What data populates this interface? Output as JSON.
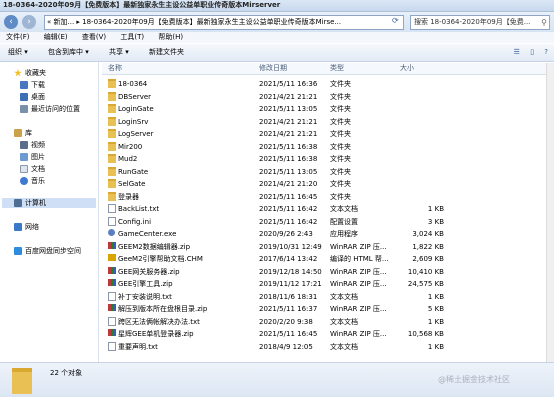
{
  "window": {
    "title": "18-0364-2020年09月【免费版本】最新独家永生主设公益单职业传奇版本Mirserver"
  },
  "address": {
    "path": "« 新加... ▸ 18-0364-2020年09月【免费版本】最新独家永生主设公益单职业传奇版本Mirse..."
  },
  "search": {
    "placeholder": "搜索 18-0364-2020年09月【免费..."
  },
  "menu": [
    "文件(F)",
    "编辑(E)",
    "查看(V)",
    "工具(T)",
    "帮助(H)"
  ],
  "toolbar": {
    "organize": "组织 ▾",
    "include": "包含到库中 ▾",
    "share": "共享 ▾",
    "new_folder": "新建文件夹"
  },
  "nav": {
    "favorites": "收藏夹",
    "favorites_items": [
      "下载",
      "桌面",
      "最近访问的位置"
    ],
    "library": "库",
    "library_items": [
      "视频",
      "图片",
      "文档",
      "音乐"
    ],
    "computer": "计算机",
    "network": "网络",
    "baidu": "百度网盘同步空间"
  },
  "columns": {
    "name": "名称",
    "date": "修改日期",
    "type": "类型",
    "size": "大小"
  },
  "files": [
    {
      "name": "18-0364",
      "date": "2021/5/11 16:36",
      "type": "文件夹",
      "size": "",
      "icon": "folder"
    },
    {
      "name": "DBServer",
      "date": "2021/4/21 21:21",
      "type": "文件夹",
      "size": "",
      "icon": "folder"
    },
    {
      "name": "LoginGate",
      "date": "2021/5/11 13:05",
      "type": "文件夹",
      "size": "",
      "icon": "folder"
    },
    {
      "name": "LoginSrv",
      "date": "2021/4/21 21:21",
      "type": "文件夹",
      "size": "",
      "icon": "folder"
    },
    {
      "name": "LogServer",
      "date": "2021/4/21 21:21",
      "type": "文件夹",
      "size": "",
      "icon": "folder"
    },
    {
      "name": "Mir200",
      "date": "2021/5/11 16:38",
      "type": "文件夹",
      "size": "",
      "icon": "folder"
    },
    {
      "name": "Mud2",
      "date": "2021/5/11 16:38",
      "type": "文件夹",
      "size": "",
      "icon": "folder"
    },
    {
      "name": "RunGate",
      "date": "2021/5/11 13:05",
      "type": "文件夹",
      "size": "",
      "icon": "folder"
    },
    {
      "name": "SelGate",
      "date": "2021/4/21 21:20",
      "type": "文件夹",
      "size": "",
      "icon": "folder"
    },
    {
      "name": "登录器",
      "date": "2021/5/11 16:45",
      "type": "文件夹",
      "size": "",
      "icon": "folder"
    },
    {
      "name": "BackList.txt",
      "date": "2021/5/11 16:42",
      "type": "文本文档",
      "size": "1 KB",
      "icon": "txt"
    },
    {
      "name": "Config.ini",
      "date": "2021/5/11 16:42",
      "type": "配置设置",
      "size": "3 KB",
      "icon": "ini"
    },
    {
      "name": "GameCenter.exe",
      "date": "2020/9/26 2:43",
      "type": "应用程序",
      "size": "3,024 KB",
      "icon": "exe"
    },
    {
      "name": "GEEM2数据编辑器.zip",
      "date": "2019/10/31 12:49",
      "type": "WinRAR ZIP 压...",
      "size": "1,822 KB",
      "icon": "zip"
    },
    {
      "name": "GeeM2引擎帮助文档.CHM",
      "date": "2017/6/14 13:42",
      "type": "编译的 HTML 帮...",
      "size": "2,609 KB",
      "icon": "chm"
    },
    {
      "name": "GEE网关服务器.zip",
      "date": "2019/12/18 14:50",
      "type": "WinRAR ZIP 压...",
      "size": "10,410 KB",
      "icon": "zip"
    },
    {
      "name": "GEE引擎工具.zip",
      "date": "2019/11/12 17:21",
      "type": "WinRAR ZIP 压...",
      "size": "24,575 KB",
      "icon": "zip"
    },
    {
      "name": "补丁安装说明.txt",
      "date": "2018/11/6 18:31",
      "type": "文本文档",
      "size": "1 KB",
      "icon": "txt"
    },
    {
      "name": "解压到版本所在盘根目录.zip",
      "date": "2021/5/11 16:37",
      "type": "WinRAR ZIP 压...",
      "size": "5 KB",
      "icon": "zip"
    },
    {
      "name": "跨区无法俩帐解决办法.txt",
      "date": "2020/2/20 9:38",
      "type": "文本文档",
      "size": "1 KB",
      "icon": "txt"
    },
    {
      "name": "星辉GEE单机登录器.zip",
      "date": "2021/5/11 16:45",
      "type": "WinRAR ZIP 压...",
      "size": "10,568 KB",
      "icon": "zip"
    },
    {
      "name": "重要声明.txt",
      "date": "2018/4/9 12:05",
      "type": "文本文档",
      "size": "1 KB",
      "icon": "txt"
    }
  ],
  "status": {
    "count": "22 个对象"
  },
  "watermark": "@稀土掘金技术社区"
}
